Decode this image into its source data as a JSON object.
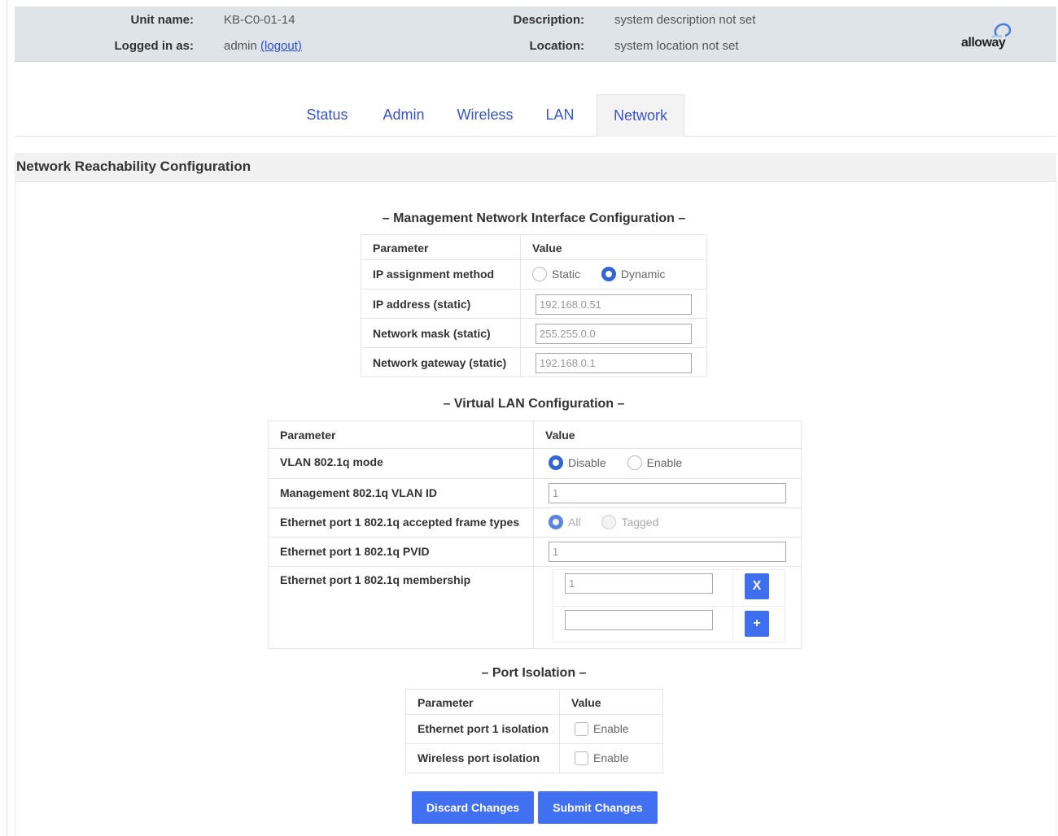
{
  "header": {
    "unit_name_label": "Unit name:",
    "unit_name_value": "KB-C0-01-14",
    "logged_in_label": "Logged in as:",
    "logged_in_user": "admin",
    "logout_link": "(logout)",
    "description_label": "Description:",
    "description_value": "system description not set",
    "location_label": "Location:",
    "location_value": "system location not set",
    "logo_text": "alloway"
  },
  "tabs": [
    {
      "label": "Status"
    },
    {
      "label": "Admin"
    },
    {
      "label": "Wireless"
    },
    {
      "label": "LAN"
    },
    {
      "label": "Network",
      "active": true
    }
  ],
  "page_title": "Network Reachability Configuration",
  "mgmt": {
    "title": "– Management Network Interface Configuration –",
    "col_param": "Parameter",
    "col_value": "Value",
    "ip_method_label": "IP assignment method",
    "ip_method_options": [
      "Static",
      "Dynamic"
    ],
    "ip_method_selected": "Dynamic",
    "ip_label": "IP address (static)",
    "ip_value": "192.168.0.51",
    "mask_label": "Network mask (static)",
    "mask_value": "255.255.0.0",
    "gw_label": "Network gateway (static)",
    "gw_value": "192.168.0.1"
  },
  "vlan": {
    "title": "– Virtual LAN Configuration –",
    "col_param": "Parameter",
    "col_value": "Value",
    "mode_label": "VLAN 802.1q mode",
    "mode_options": [
      "Disable",
      "Enable"
    ],
    "mode_selected": "Disable",
    "mgmt_vlan_label": "Management 802.1q VLAN ID",
    "mgmt_vlan_value": "1",
    "frame_types_label": "Ethernet port 1 802.1q accepted frame types",
    "frame_types_options": [
      "All",
      "Tagged"
    ],
    "frame_types_selected": "All",
    "pvid_label": "Ethernet port 1 802.1q PVID",
    "pvid_value": "1",
    "membership_label": "Ethernet port 1 802.1q membership",
    "membership_values": [
      "1",
      ""
    ],
    "remove_button": "X",
    "add_button": "+"
  },
  "isolation": {
    "title": "– Port Isolation –",
    "col_param": "Parameter",
    "col_value": "Value",
    "eth_label": "Ethernet port 1 isolation",
    "eth_option": "Enable",
    "wifi_label": "Wireless port isolation",
    "wifi_option": "Enable"
  },
  "buttons": {
    "discard": "Discard Changes",
    "submit": "Submit Changes"
  },
  "colors": {
    "accent": "#4170f2",
    "tab_text": "#3a55c8",
    "header_bg": "#dfe4e8"
  }
}
